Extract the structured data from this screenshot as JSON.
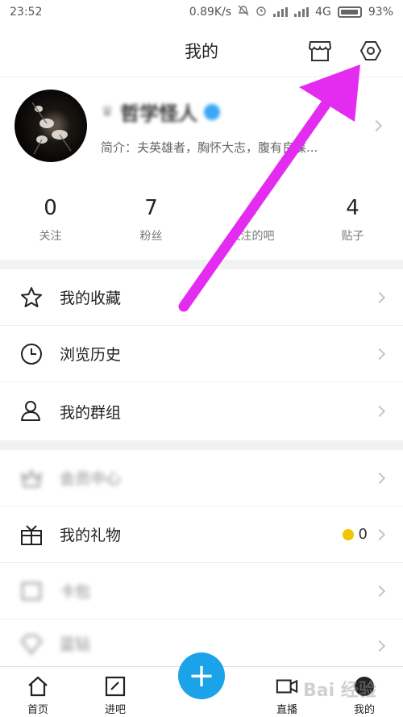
{
  "status_bar": {
    "time": "23:52",
    "net_speed": "0.89K/s",
    "network": "4G",
    "battery": "93%"
  },
  "header": {
    "title": "我的",
    "store_icon": "store-icon",
    "settings_icon": "settings-icon"
  },
  "profile": {
    "username": "哲学怪人",
    "intro": "简介：夫英雄者，胸怀大志，腹有良谋..."
  },
  "stats": [
    {
      "value": "0",
      "label": "关注"
    },
    {
      "value": "7",
      "label": "粉丝"
    },
    {
      "value": "4",
      "label": "关注的吧"
    },
    {
      "value": "4",
      "label": "贴子"
    }
  ],
  "menu": {
    "favorites": "我的收藏",
    "history": "浏览历史",
    "groups": "我的群组",
    "member_center": "会员中心",
    "gifts": "我的礼物",
    "gifts_count": "0",
    "card_wallet": "卡包",
    "tdou": "蓝钻"
  },
  "tabbar": {
    "home": "首页",
    "enter_bar": "进吧",
    "post": "+",
    "live": "直播",
    "mine": "我的"
  },
  "watermark": "Bai 经验",
  "colors": {
    "accent": "#1aa3e8",
    "arrow": "#e32cf0"
  }
}
